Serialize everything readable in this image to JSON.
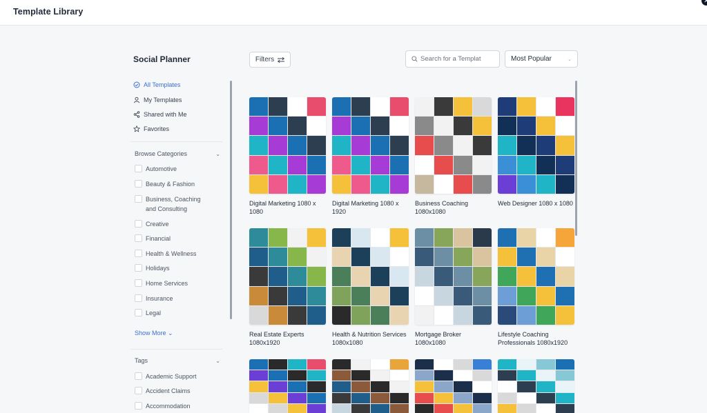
{
  "header": {
    "title": "Template Library"
  },
  "sidebar": {
    "title": "Social Planner",
    "nav": [
      {
        "label": "All Templates",
        "icon": "check-circle-icon",
        "active": true
      },
      {
        "label": "My Templates",
        "icon": "user-icon",
        "active": false
      },
      {
        "label": "Shared with Me",
        "icon": "share-icon",
        "active": false
      },
      {
        "label": "Favorites",
        "icon": "star-icon",
        "active": false
      }
    ],
    "categories_heading": "Browse Categories",
    "categories": [
      "Automotive",
      "Beauty & Fashion",
      "Business, Coaching and Consulting",
      "Creative",
      "Financial",
      "Health & Wellness",
      "Holidays",
      "Home Services",
      "Insurance",
      "Legal"
    ],
    "show_more": "Show More",
    "tags_heading": "Tags",
    "tags": [
      "Academic Support",
      "Accident Claims",
      "Accommodation"
    ]
  },
  "toolbar": {
    "filters_label": "Filters",
    "search_placeholder": "Search for a Templat",
    "sort_label": "Most Popular"
  },
  "templates": [
    {
      "label": "Digital Marketing 1080 x 1080",
      "palette": [
        "#1b6fb3",
        "#e84d6d",
        "#1fb5c7",
        "#2d3e50",
        "#f6c13a",
        "#a63bd6",
        "#ffffff",
        "#ef5a8c"
      ]
    },
    {
      "label": "Digital Marketing 1080 x 1920",
      "palette": [
        "#1b6fb3",
        "#e84d6d",
        "#1fb5c7",
        "#2d3e50",
        "#f6c13a",
        "#a63bd6",
        "#ffffff",
        "#ef5a8c"
      ]
    },
    {
      "label": "Business Coaching 1080x1080",
      "palette": [
        "#f2f2f2",
        "#d9d9d9",
        "#e84d4d",
        "#3a3a3a",
        "#c6b79f",
        "#8a8a8a",
        "#f6c13a",
        "#ffffff"
      ]
    },
    {
      "label": "Web Designer 1080 x 1080",
      "palette": [
        "#1d3c78",
        "#e8345f",
        "#1fb5c7",
        "#f6c13a",
        "#6b3fd6",
        "#123056",
        "#ffffff",
        "#3a8fd6"
      ]
    },
    {
      "label": "Real Estate Experts 1080x1920",
      "palette": [
        "#2e8b9a",
        "#f6c13a",
        "#3a3a3a",
        "#87b64b",
        "#d9d9d9",
        "#1f5d8a",
        "#f2f2f2",
        "#c98a3a"
      ]
    },
    {
      "label": "Health & Nutrition Services 1080x1080",
      "palette": [
        "#1c3f5a",
        "#f6c13a",
        "#4a7f5a",
        "#d9e8f0",
        "#2a2a2a",
        "#e8d4b0",
        "#ffffff",
        "#7fa35a"
      ]
    },
    {
      "label": "Mortgage Broker 1080x1080",
      "palette": [
        "#6d8fa6",
        "#2a3a4a",
        "#c8d6e0",
        "#87a65a",
        "#f2f2f2",
        "#3a5a7a",
        "#d9c49f",
        "#ffffff"
      ]
    },
    {
      "label": "Lifestyle Coaching Professionals 1080x1920",
      "palette": [
        "#1f6fb3",
        "#f6a53a",
        "#3fa65a",
        "#e8d4a6",
        "#2a4a7a",
        "#f6c13a",
        "#ffffff",
        "#6d9fd6"
      ]
    },
    {
      "label": "",
      "palette": [
        "#1b6fb3",
        "#e84d6d",
        "#f6c13a",
        "#2a2a2a",
        "#ffffff",
        "#6b3fd6",
        "#1fb5c7",
        "#d9d9d9"
      ]
    },
    {
      "label": "",
      "palette": [
        "#2a2a2a",
        "#e8a63a",
        "#1f5d8a",
        "#f2f2f2",
        "#c8d6e0",
        "#8a5a3a",
        "#ffffff",
        "#3a3a3a"
      ]
    },
    {
      "label": "",
      "palette": [
        "#1c2f4a",
        "#3a7fd6",
        "#f6c13a",
        "#ffffff",
        "#2a2a2a",
        "#8aa6c8",
        "#d9d9d9",
        "#e84d4d"
      ]
    },
    {
      "label": "",
      "palette": [
        "#1fb5c7",
        "#1b6fb3",
        "#ffffff",
        "#e8f4f8",
        "#f6c13a",
        "#2d3e50",
        "#87c8d6",
        "#d9d9d9"
      ]
    }
  ]
}
